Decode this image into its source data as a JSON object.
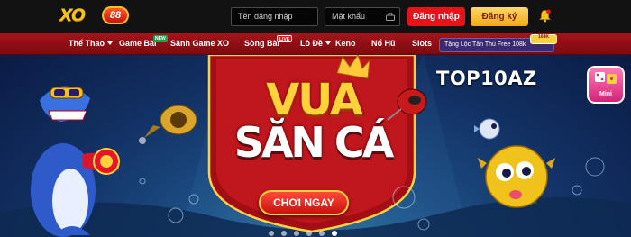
{
  "header": {
    "logo_text": "XO",
    "logo_badge": "88",
    "username_placeholder": "Tên đăng nhập",
    "password_placeholder": "Mật khẩu",
    "login_label": "Đăng nhập",
    "register_label": "Đăng ký",
    "notification_icon": "bell-icon"
  },
  "nav": {
    "items": [
      {
        "label": "Thể Thao",
        "caret": true
      },
      {
        "label": "Game Bài",
        "badge": "NEW"
      },
      {
        "label": "Sảnh Game XO"
      },
      {
        "label": "Sòng Bài",
        "badge": "LIVE"
      },
      {
        "label": "Lô Đề",
        "caret": true
      },
      {
        "label": "Keno"
      },
      {
        "label": "Nổ Hũ"
      },
      {
        "label": "Slots"
      }
    ],
    "promo_text": "Tặng Lộc Tân Thủ Free 108k",
    "promo_badge": "108K"
  },
  "banner": {
    "title_line1": "VUA",
    "title_line2": "SĂN CÁ",
    "cta_label": "CHƠI NGAY",
    "watermark": "TOP10AZ",
    "mini_app_label": "Mini",
    "carousel_dots": 6,
    "active_dot": 5
  },
  "colors": {
    "brand_red": "#e8131a",
    "brand_gold": "#ffd23a",
    "nav_red": "#a4141b"
  }
}
